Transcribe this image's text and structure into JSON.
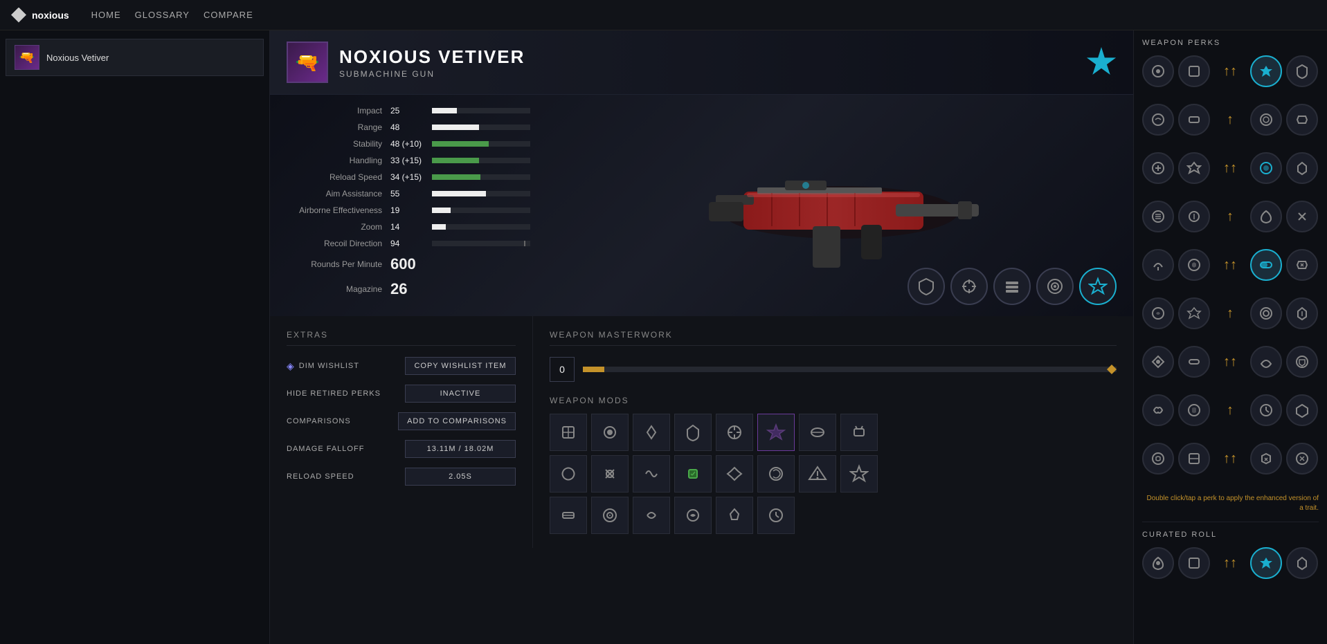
{
  "app": {
    "logo_text": "noxious",
    "nav": {
      "home": "HOME",
      "glossary": "GLOSSARY",
      "compare": "COMPARE"
    }
  },
  "sidebar": {
    "item": {
      "name": "Noxious Vetiver",
      "thumb_emoji": "🔫"
    }
  },
  "weapon": {
    "name": "NOXIOUS VETIVER",
    "type": "SUBMACHINE GUN",
    "thumb_emoji": "🔫",
    "stats": [
      {
        "name": "Impact",
        "value": "25",
        "bar_pct": 25,
        "enhanced": false,
        "is_large": false
      },
      {
        "name": "Range",
        "value": "48",
        "bar_pct": 48,
        "enhanced": false,
        "is_large": false
      },
      {
        "name": "Stability",
        "value": "48 (+10)",
        "bar_pct": 58,
        "enhanced": true,
        "is_large": false
      },
      {
        "name": "Handling",
        "value": "33 (+15)",
        "bar_pct": 48,
        "enhanced": true,
        "is_large": false
      },
      {
        "name": "Reload Speed",
        "value": "34 (+15)",
        "bar_pct": 49,
        "enhanced": true,
        "is_large": false
      },
      {
        "name": "Aim Assistance",
        "value": "55",
        "bar_pct": 55,
        "enhanced": false,
        "is_large": false
      },
      {
        "name": "Airborne Effectiveness",
        "value": "19",
        "bar_pct": 19,
        "enhanced": false,
        "is_large": false
      },
      {
        "name": "Zoom",
        "value": "14",
        "bar_pct": 14,
        "enhanced": false,
        "is_large": false
      },
      {
        "name": "Recoil Direction",
        "value": "94",
        "bar_pct": 94,
        "enhanced": false,
        "is_large": false,
        "is_recoil": true
      },
      {
        "name": "Rounds Per Minute",
        "value": "600",
        "bar_pct": 0,
        "enhanced": false,
        "is_large": true
      },
      {
        "name": "Magazine",
        "value": "26",
        "bar_pct": 0,
        "enhanced": false,
        "is_large": true
      }
    ],
    "perks_row": [
      "⚙️",
      "🔄",
      "⬤",
      "◎",
      "✦"
    ],
    "mods_row1": [
      "🔷",
      "🔴",
      "⚙",
      "◈",
      "◎",
      "🟣",
      "⬭",
      "◑"
    ],
    "mods_row2": [
      "🔧",
      "✕",
      "🔄",
      "🟩",
      "◈",
      "❄️",
      "◉",
      "◀"
    ],
    "mods_row3": [
      "✦",
      "🔗",
      "◯",
      "◑",
      "◎"
    ],
    "masterwork": {
      "level": "0"
    }
  },
  "extras": {
    "title": "EXTRAS",
    "dim_wishlist_label": "DIM WISHLIST",
    "dim_wishlist_btn": "COPY WISHLIST ITEM",
    "hide_retired_label": "HIDE RETIRED PERKS",
    "hide_retired_btn": "INACTIVE",
    "comparisons_label": "COMPARISONS",
    "comparisons_btn": "ADD TO COMPARISONS",
    "damage_falloff_label": "DAMAGE FALLOFF",
    "damage_falloff_value": "13.11m / 18.02m",
    "reload_speed_label": "RELOAD SPEED",
    "reload_speed_value": "2.05s"
  },
  "masterwork_section": {
    "title": "WEAPON MASTERWORK"
  },
  "mods_section": {
    "title": "WEAPON MODS"
  },
  "right_panel": {
    "perks_title": "WEAPON PERKS",
    "hint": "Double click/tap a perk to apply\nthe enhanced version of a trait.",
    "curated_title": "CURATED ROLL",
    "perk_rows": [
      [
        "◉",
        "◈",
        "↑↑",
        "◎",
        "⚙"
      ],
      [
        "◉",
        "◈",
        "↑",
        "◎",
        "⚙"
      ],
      [
        "◉",
        "◈",
        "↑↑",
        "◎",
        "⚙"
      ],
      [
        "◉",
        "◈",
        "↑",
        "◎",
        "⚙"
      ],
      [
        "◉",
        "◈",
        "↑↑",
        "◎",
        "⚙"
      ],
      [
        "◉",
        "◈",
        "↑",
        "◎",
        "⚙"
      ],
      [
        "◉",
        "◈",
        "↑↑",
        "◎",
        "⚙"
      ],
      [
        "◉",
        "◈",
        "↑",
        "◎",
        "⚙"
      ],
      [
        "◉",
        "◈",
        "↑↑",
        "◎",
        "⚙"
      ]
    ],
    "curated_perks": [
      "◉",
      "◈",
      "↑↑",
      "◎",
      "⚙"
    ]
  }
}
